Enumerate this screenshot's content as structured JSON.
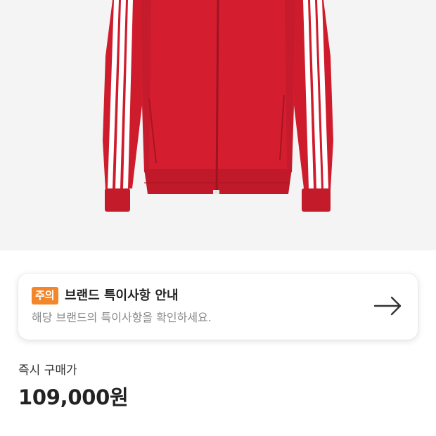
{
  "product_image": {
    "icon": "red-track-jacket-image",
    "colors": {
      "body": "#d41e30",
      "shadow": "#a8141f",
      "stripe": "#ffffff",
      "background": "#f4f4f4"
    }
  },
  "notice": {
    "badge": "주의",
    "title": "브랜드 특이사항 안내",
    "description": "해당 브랜드의 특이사항을 확인하세요.",
    "arrow_icon": "arrow-right-icon",
    "badge_color": "#f2862a"
  },
  "price": {
    "label": "즉시 구매가",
    "value": "109,000원"
  }
}
